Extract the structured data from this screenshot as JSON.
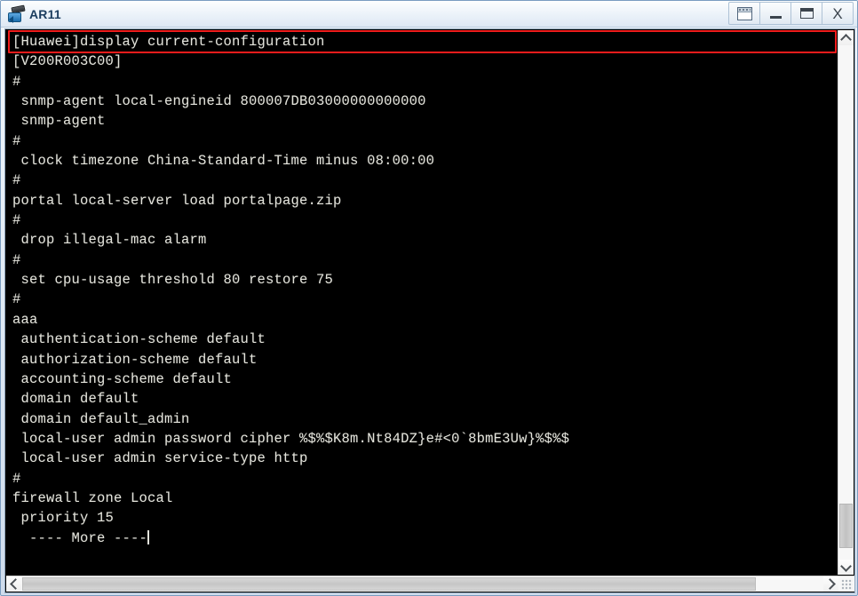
{
  "window": {
    "title": "AR11",
    "icon": "router-device-icon",
    "controls": [
      {
        "name": "restore-all-windows-button",
        "glyph": "window-cascade-icon",
        "label": ""
      },
      {
        "name": "minimize-button",
        "glyph": "minimize-icon",
        "label": ""
      },
      {
        "name": "maximize-button",
        "glyph": "maximize-icon",
        "label": ""
      },
      {
        "name": "close-button",
        "glyph": "close-icon",
        "label": "X"
      }
    ]
  },
  "terminal": {
    "prompt_line": "[Huawei]display current-configuration",
    "highlighted_line_index": 0,
    "pager_prompt": "  ---- More ----",
    "lines": [
      "[Huawei]display current-configuration",
      "[V200R003C00]",
      "#",
      " snmp-agent local-engineid 800007DB03000000000000",
      " snmp-agent",
      "#",
      " clock timezone China-Standard-Time minus 08:00:00",
      "#",
      "portal local-server load portalpage.zip",
      "#",
      " drop illegal-mac alarm",
      "#",
      " set cpu-usage threshold 80 restore 75",
      "#",
      "aaa",
      " authentication-scheme default",
      " authorization-scheme default",
      " accounting-scheme default",
      " domain default",
      " domain default_admin",
      " local-user admin password cipher %$%$K8m.Nt84DZ}e#<0`8bmE3Uw}%$%$",
      " local-user admin service-type http",
      "#",
      "firewall zone Local",
      " priority 15"
    ],
    "colors": {
      "background": "#000000",
      "foreground": "#e4e4dc",
      "highlight_rect": "#f01c1c"
    }
  },
  "scrollbars": {
    "vertical": {
      "up_arrow": "chevron-up-icon",
      "down_arrow": "chevron-down-icon",
      "thumb_position_percent": 90
    },
    "horizontal": {
      "left_arrow": "chevron-left-icon",
      "right_arrow": "chevron-right-icon",
      "thumb_position_percent": 0
    }
  }
}
